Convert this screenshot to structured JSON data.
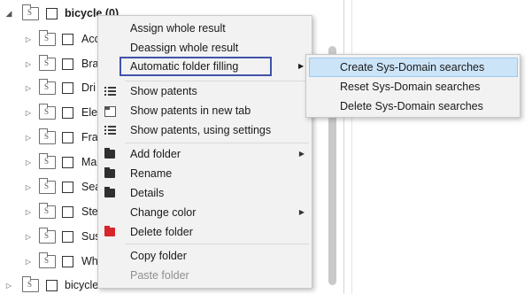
{
  "tree": {
    "rows": [
      {
        "label": "bicycle (0)",
        "bold": true,
        "expanded": true
      },
      {
        "label": "Acc"
      },
      {
        "label": "Bra"
      },
      {
        "label": "Dri"
      },
      {
        "label": "Ele"
      },
      {
        "label": "Fra"
      },
      {
        "label": "Ma"
      },
      {
        "label": "Sea"
      },
      {
        "label": "Ste"
      },
      {
        "label": "Sus"
      },
      {
        "label": "Wh"
      },
      {
        "label": "bicycle"
      }
    ],
    "folder_icon_letter": "S"
  },
  "context_menu": {
    "items": [
      {
        "label": "Assign whole result"
      },
      {
        "label": "Deassign whole result"
      },
      {
        "label": "Automatic folder filling",
        "submenu": true
      },
      {
        "label": "Show patents",
        "icon": "list-icon"
      },
      {
        "label": "Show patents in new tab",
        "icon": "new-tab-icon"
      },
      {
        "label": "Show patents, using settings",
        "icon": "list-settings-icon"
      },
      {
        "label": "Add folder",
        "icon": "add-folder-icon",
        "submenu": true
      },
      {
        "label": "Rename",
        "icon": "rename-folder-icon"
      },
      {
        "label": "Details",
        "icon": "details-folder-icon"
      },
      {
        "label": "Change color",
        "submenu": true
      },
      {
        "label": "Delete folder",
        "icon": "delete-folder-icon"
      },
      {
        "label": "Copy folder"
      },
      {
        "label": "Paste folder",
        "disabled": true
      }
    ],
    "submenu_arrow": "▶"
  },
  "submenu": {
    "items": [
      {
        "label": "Create Sys-Domain searches"
      },
      {
        "label": "Reset Sys-Domain searches"
      },
      {
        "label": "Delete Sys-Domain searches"
      }
    ]
  },
  "tree_arrows": {
    "expanded": "◢",
    "collapsed": "▷"
  },
  "colors": {
    "focus_outline": "#3f53a8",
    "hover_bg": "#cce4f7",
    "menu_bg": "#f2f2f2",
    "delete_icon": "#d6252b"
  }
}
